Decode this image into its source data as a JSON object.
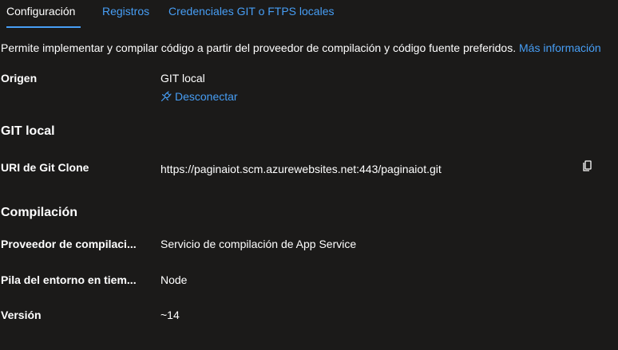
{
  "tabs": [
    {
      "label": "Configuración",
      "active": true
    },
    {
      "label": "Registros",
      "active": false
    },
    {
      "label": "Credenciales GIT o FTPS locales",
      "active": false
    }
  ],
  "description": {
    "text": "Permite implementar y compilar código a partir del proveedor de compilación y código fuente preferidos.",
    "link": "Más información"
  },
  "source": {
    "label": "Origen",
    "value": "GIT local",
    "disconnect_label": "Desconectar",
    "disconnect_icon": "plug-disconnect-icon"
  },
  "git_local": {
    "title": "GIT local",
    "clone_label": "URI de Git Clone",
    "clone_value": "https://paginaiot.scm.azurewebsites.net:443/paginaiot.git",
    "copy_icon": "copy-icon"
  },
  "build": {
    "title": "Compilación",
    "provider_label": "Proveedor de compilaci...",
    "provider_value": "Servicio de compilación de App Service",
    "stack_label": "Pila del entorno en tiem...",
    "stack_value": "Node",
    "version_label": "Versión",
    "version_value": "~14"
  },
  "colors": {
    "background": "#1b1a19",
    "accent": "#479ef5",
    "text": "#ffffff"
  }
}
